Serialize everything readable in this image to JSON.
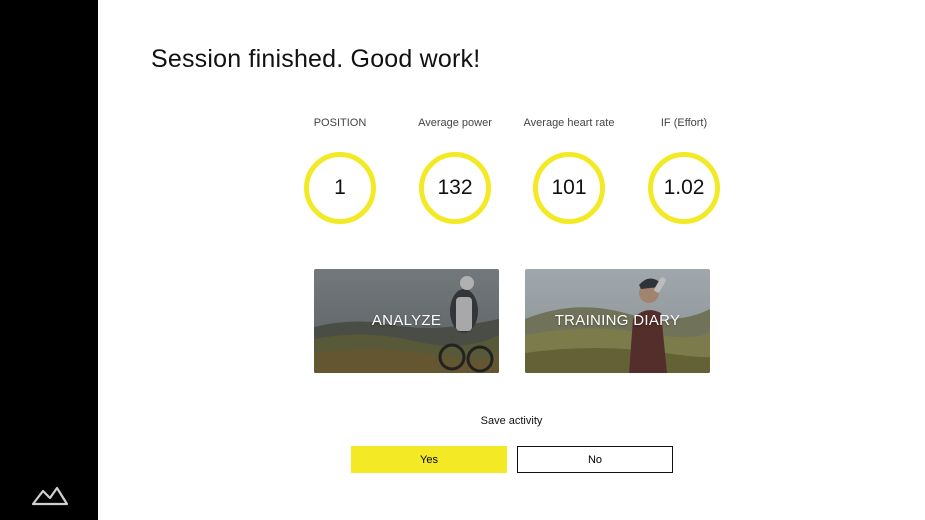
{
  "title": "Session finished. Good work!",
  "stats": [
    {
      "label": "POSITION",
      "value": "1"
    },
    {
      "label": "Average power",
      "value": "132"
    },
    {
      "label": "Average heart rate",
      "value": "101"
    },
    {
      "label": "IF (Effort)",
      "value": "1.02"
    }
  ],
  "cards": [
    {
      "label": "ANALYZE"
    },
    {
      "label": "TRAINING DIARY"
    }
  ],
  "save": {
    "label": "Save activity",
    "yes_label": "Yes",
    "no_label": "No"
  },
  "colors": {
    "accent": "#f3ea25",
    "sidebar": "#000000"
  },
  "icons": {
    "logo": "mountain-logo-icon"
  }
}
